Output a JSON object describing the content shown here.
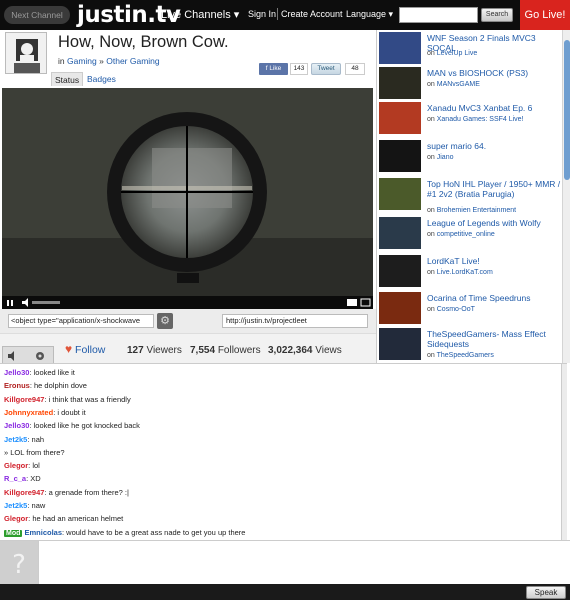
{
  "topbar": {
    "next_channel": "Next Channel",
    "logo": "justin.tv",
    "live_channels": "Live Channels ▾",
    "sign_in": "Sign In",
    "create_account": "Create Account",
    "language": "Language ▾",
    "search_placeholder": "",
    "search_button": "Search",
    "go_live": "Go Live!"
  },
  "channel": {
    "title": "How, Now, Brown Cow.",
    "in_label": "in",
    "category": "Gaming",
    "category_sep": "»",
    "subcategory": "Other Gaming",
    "like_label": "Like",
    "like_count": "143",
    "tweet_label": "Tweet",
    "tweet_count": "48",
    "tabs": [
      {
        "label": "Status"
      },
      {
        "label": "Badges"
      }
    ]
  },
  "embed": {
    "code": "<object type=\"application/x-shockwave",
    "url": "http://justin.tv/projectleet"
  },
  "stats": {
    "follow": "Follow",
    "viewers_count": "127",
    "viewers_label": "Viewers",
    "followers_count": "7,554",
    "followers_label": "Followers",
    "views_count": "3,022,364",
    "views_label": "Views"
  },
  "chat": {
    "messages": [
      {
        "user": "Jello30",
        "text": ": looked like it",
        "color": "#8a2be2"
      },
      {
        "user": "Eronus",
        "text": ": he dolphin dove",
        "color": "#b22222"
      },
      {
        "user": "Killgore947",
        "text": ": i think that was a friendly",
        "color": "#d2222d"
      },
      {
        "user": "Johnnyxrated",
        "text": ": i doubt it",
        "color": "#ff4500"
      },
      {
        "user": "Jello30",
        "text": ": looked like he got knocked back",
        "color": "#8a2be2"
      },
      {
        "user": "Jet2k5",
        "text": ": nah",
        "color": "#1e90ff"
      },
      {
        "user": "",
        "text": "» LOL from there?",
        "color": "#333333"
      },
      {
        "user": "Glegor",
        "text": ": lol",
        "color": "#d2222d"
      },
      {
        "user": "R_c_a",
        "text": ": XD",
        "color": "#8a2be2"
      },
      {
        "user": "Killgore947",
        "text": ": a grenade from there? :|",
        "color": "#d2222d"
      },
      {
        "user": "Jet2k5",
        "text": ": naw",
        "color": "#1e90ff"
      },
      {
        "user": "Glegor",
        "text": ": he had an american helmet",
        "color": "#d2222d"
      },
      {
        "user": "Emnicolas",
        "text": ": would have to be a great ass nade to get you up there",
        "color": "#1f5aa8"
      }
    ],
    "mod_badge": "Mod",
    "speak_button": "Speak"
  },
  "sidebar": {
    "on_label": "on",
    "items": [
      {
        "title": "WNF Season 2 Finals MVC3 SOCAL",
        "channel": "LevelUp Live",
        "thumb_color": "#324a86"
      },
      {
        "title": "MAN vs BIOSHOCK (PS3)",
        "channel": "MANvsGAME",
        "thumb_color": "#2a2a20"
      },
      {
        "title": "Xanadu MvC3 Xanbat Ep. 6",
        "channel": "Xanadu Games: SSF4 Live!",
        "thumb_color": "#b33a22"
      },
      {
        "title": "super mario 64.",
        "channel": "Jiano",
        "thumb_color": "#141414"
      },
      {
        "title": "Top HoN IHL Player / 1950+ MMR / #1 2v2 (Bratia Parugia)",
        "channel": "Brohemien Entertainment",
        "thumb_color": "#4b5a2a"
      },
      {
        "title": "League of Legends with Wolfy",
        "channel": "competitive_online",
        "thumb_color": "#2a3a4a"
      },
      {
        "title": "LordKaT Live!",
        "channel": "Live.LordKaT.com",
        "thumb_color": "#1d1d1d"
      },
      {
        "title": "Ocarina of Time Speedruns",
        "channel": "Cosmo-OoT",
        "thumb_color": "#7a2a10"
      },
      {
        "title": "TheSpeedGamers- Mass Effect Sidequests",
        "channel": "TheSpeedGamers",
        "thumb_color": "#222a3a"
      }
    ]
  }
}
